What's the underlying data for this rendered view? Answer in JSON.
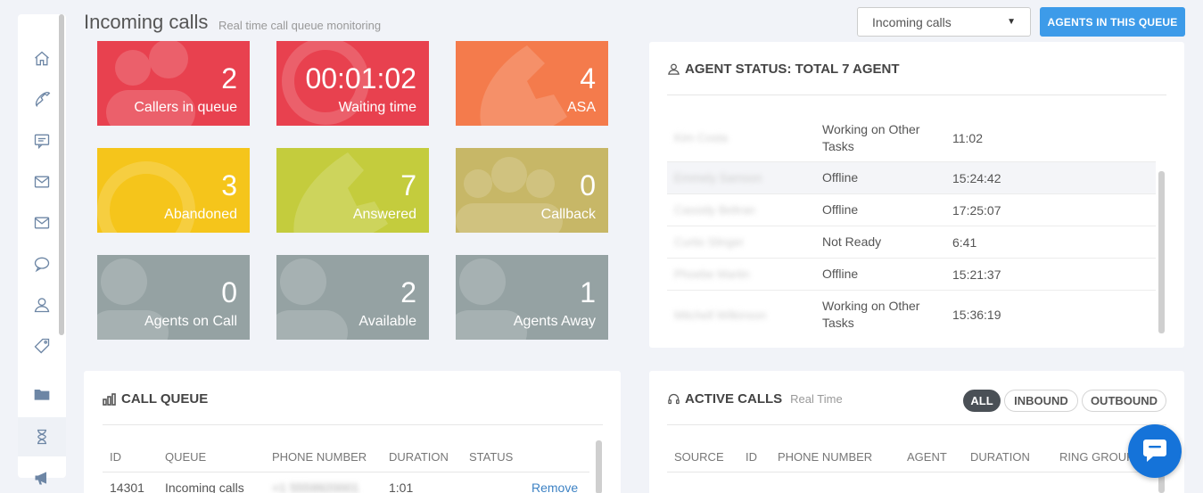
{
  "header": {
    "title": "Incoming calls",
    "subtitle": "Real time call queue monitoring",
    "queue_select_value": "Incoming calls",
    "agents_button": "AGENTS IN THIS QUEUE"
  },
  "sidebar": {
    "items": [
      {
        "icon": "home-icon"
      },
      {
        "icon": "phone-icon"
      },
      {
        "icon": "chat-icon"
      },
      {
        "icon": "mail-icon"
      },
      {
        "icon": "inbox-icon"
      },
      {
        "icon": "bubble-icon"
      },
      {
        "icon": "user-icon"
      },
      {
        "icon": "tag-icon"
      },
      {
        "icon": "folder-icon"
      },
      {
        "icon": "hourglass-icon"
      },
      {
        "icon": "megaphone-icon"
      }
    ]
  },
  "tiles": [
    {
      "value": "2",
      "label": "Callers in queue",
      "color": "#e8414f"
    },
    {
      "value": "00:01:02",
      "label": "Waiting time",
      "color": "#e8414f"
    },
    {
      "value": "4",
      "label": "ASA",
      "color": "#f47b4c"
    },
    {
      "value": "3",
      "label": "Abandoned",
      "color": "#f5c51b"
    },
    {
      "value": "7",
      "label": "Answered",
      "color": "#c4cc3d"
    },
    {
      "value": "0",
      "label": "Callback",
      "color": "#c7b767"
    },
    {
      "value": "0",
      "label": "Agents on Call",
      "color": "#95a2a3"
    },
    {
      "value": "2",
      "label": "Available",
      "color": "#95a2a3"
    },
    {
      "value": "1",
      "label": "Agents Away",
      "color": "#95a2a3"
    }
  ],
  "agent_status": {
    "title": "AGENT STATUS: TOTAL 7 AGENT",
    "rows": [
      {
        "name": "Kim Costa",
        "status": "Working on Other Tasks",
        "time": "11:02"
      },
      {
        "name": "Emmely Samson",
        "status": "Offline",
        "time": "15:24:42"
      },
      {
        "name": "Cassidy Beltran",
        "status": "Offline",
        "time": "17:25:07"
      },
      {
        "name": "Curtis Slinger",
        "status": "Not Ready",
        "time": "6:41"
      },
      {
        "name": "Phoebe Martin",
        "status": "Offline",
        "time": "15:21:37"
      },
      {
        "name": "Mitchell Wilkinson",
        "status": "Working on Other Tasks",
        "time": "15:36:19"
      }
    ]
  },
  "call_queue": {
    "title": "CALL QUEUE",
    "columns": [
      "ID",
      "QUEUE",
      "PHONE NUMBER",
      "DURATION",
      "STATUS"
    ],
    "rows": [
      {
        "id": "14301",
        "queue": "Incoming calls",
        "phone": "+1 5559920001",
        "duration": "1:01",
        "action": "Remove"
      }
    ]
  },
  "active_calls": {
    "title": "ACTIVE CALLS",
    "subtitle": "Real Time",
    "filters": [
      "ALL",
      "INBOUND",
      "OUTBOUND"
    ],
    "columns": [
      "SOURCE",
      "ID",
      "PHONE NUMBER",
      "AGENT",
      "DURATION",
      "RING GROUP"
    ]
  },
  "colors": {
    "accent": "#3d9be9",
    "chat_fab": "#1573d9"
  }
}
